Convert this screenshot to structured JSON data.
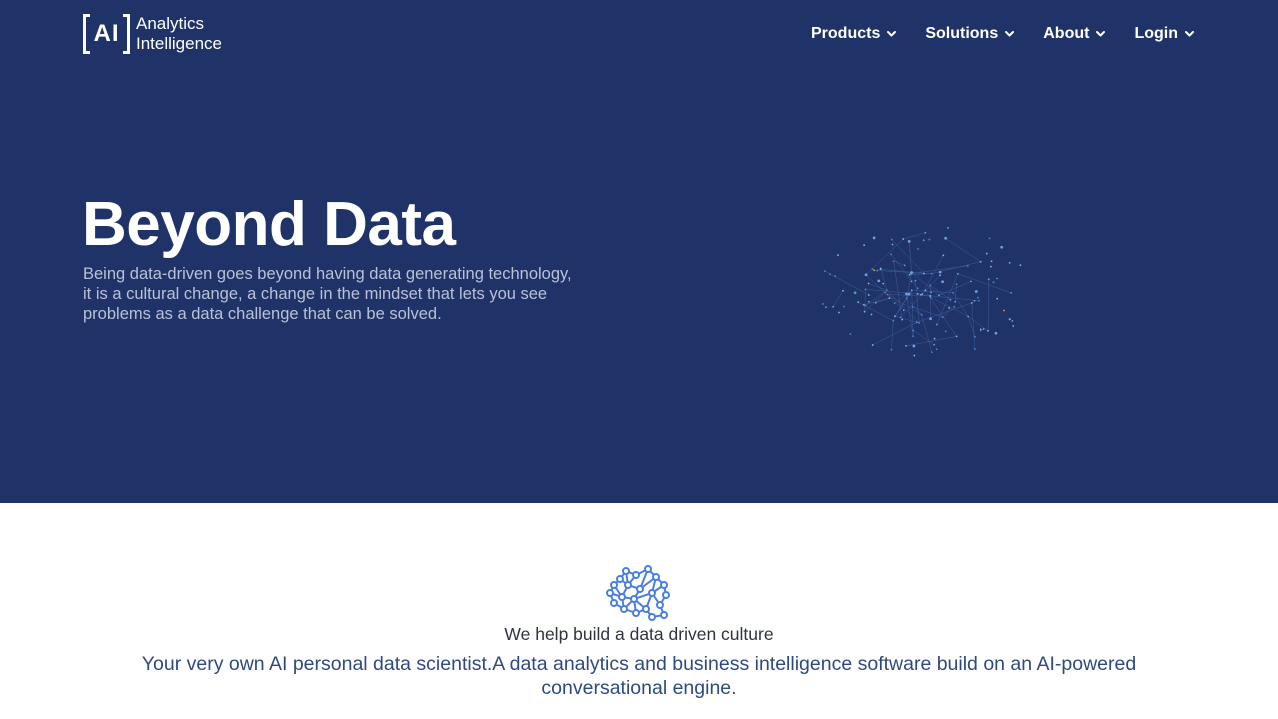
{
  "logo": {
    "mark": "AI",
    "line1": "Analytics",
    "line2": "Intelligence"
  },
  "nav": {
    "items": [
      {
        "label": "Products",
        "icon": "chevron-down-icon"
      },
      {
        "label": "Solutions",
        "icon": "chevron-down-icon"
      },
      {
        "label": "About",
        "icon": "chevron-down-icon"
      },
      {
        "label": "Login",
        "icon": "chevron-down-icon"
      }
    ]
  },
  "hero": {
    "title": "Beyond Data",
    "description_lines": [
      "Being data-driven goes beyond having data generating technology,",
      "it is a cultural change, a change in the mindset that lets you see",
      "problems as a data challenge that can be solved."
    ],
    "graphic": "network-graph"
  },
  "culture": {
    "icon": "brain-network-icon",
    "heading": "We help build a data driven culture",
    "description_lines": [
      "Your very own AI personal data scientist.A data analytics and business intelligence software build on an AI-powered",
      "conversational engine."
    ]
  },
  "colors": {
    "hero_background": "#1f3369",
    "hero_text": "#ffffff",
    "hero_subtext": "#b9c1d6",
    "accent_blue": "#4a7fe0",
    "heading_text": "#2f3440",
    "body_blue": "#2e4a7e"
  }
}
